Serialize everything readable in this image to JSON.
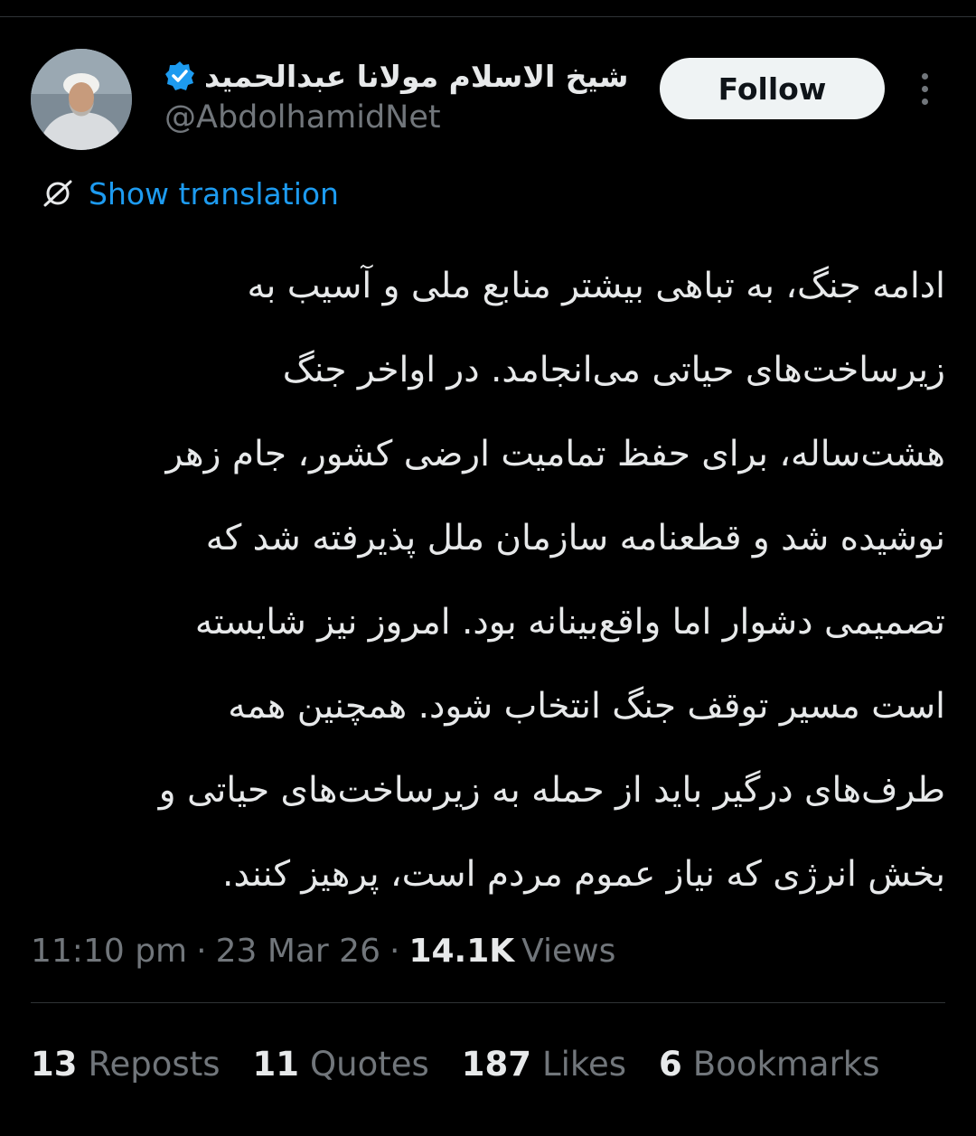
{
  "author": {
    "display_name": "شیخ الاسلام مولانا عبدالحمید",
    "handle": "@AbdolhamidNet",
    "verified": true,
    "avatar_icon": "profile-photo"
  },
  "follow_label": "Follow",
  "more_icon": "more-vertical-icon",
  "translation": {
    "icon": "globe-translate-icon",
    "label": "Show translation"
  },
  "tweet_lines": [
    "ادامه جنگ، به تباهی بیشتر منابع ملی و آسیب به",
    "زیرساخت‌های حیاتی می‌انجامد. در اواخر جنگ",
    "هشت‌ساله، برای حفظ تمامیت ارضی کشور، جام زهر",
    "نوشیده شد و قطعنامه سازمان ملل پذیرفته شد که",
    "تصمیمی دشوار اما واقع‌بینانه بود. امروز نیز شایسته",
    "است مسیر توقف جنگ انتخاب شود. همچنین همه",
    "طرف‌های درگیر باید از حمله به زیرساخت‌های حیاتی و",
    "بخش انرژی که نیاز عموم مردم است، پرهیز کنند."
  ],
  "meta": {
    "time": "11:10 pm",
    "separator": "·",
    "date": "23 Mar 26",
    "views_count": "14.1K",
    "views_label": "Views"
  },
  "stats": {
    "reposts_count": "13",
    "reposts_label": "Reposts",
    "quotes_count": "11",
    "quotes_label": "Quotes",
    "likes_count": "187",
    "likes_label": "Likes",
    "bookmarks_count": "6",
    "bookmarks_label": "Bookmarks"
  },
  "colors": {
    "background": "#000000",
    "text": "#e7e9ea",
    "secondary": "#71767b",
    "accent": "#1d9bf0",
    "divider": "#2f3336"
  }
}
